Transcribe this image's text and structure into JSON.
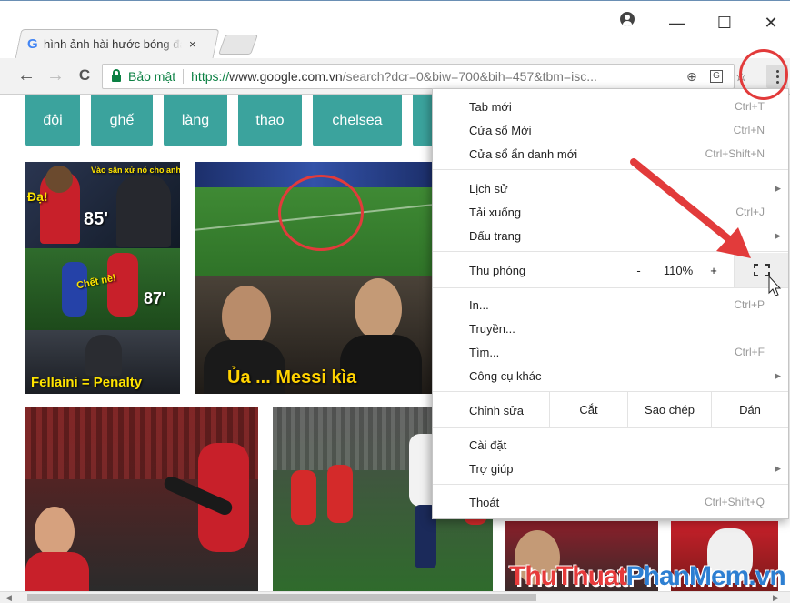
{
  "tab": {
    "icon": "G",
    "title": "hình ảnh hài hước bóng đá",
    "close": "×"
  },
  "window_controls": {
    "minimize": "—",
    "maximize": "☐",
    "close": "✕"
  },
  "toolbar": {
    "back": "←",
    "forward": "→",
    "reload": "C",
    "secure_label": "Bảo mật",
    "url_scheme": "https://",
    "url_host": "www.google.com.vn",
    "url_rest": "/search?dcr=0&biw=700&bih=457&tbm=isc...",
    "zoom_icon": "⊕",
    "translate_icon": "G",
    "bookmark_icon": "☆"
  },
  "chips": [
    "đội",
    "ghế",
    "làng",
    "thao",
    "chelsea"
  ],
  "captions": {
    "img1_top": "Vào sân xử nó cho anh!",
    "img1_da": "Đạ!",
    "img1_85": "85'",
    "img1_chet": "Chết nè!",
    "img1_87": "87'",
    "img1_bottom": "Fellaini = Penalty",
    "img2_bottom": "Ủa ... Messi kìa"
  },
  "watermark": {
    "part1": "ThuThuat",
    "part2": "PhanMem",
    "part3": ".vn"
  },
  "menu": {
    "items_top": [
      {
        "label": "Tab mới",
        "shortcut": "Ctrl+T"
      },
      {
        "label": "Cửa sổ Mới",
        "shortcut": "Ctrl+N"
      },
      {
        "label": "Cửa sổ ẩn danh mới",
        "shortcut": "Ctrl+Shift+N"
      }
    ],
    "items_history": [
      {
        "label": "Lịch sử",
        "shortcut": ""
      },
      {
        "label": "Tải xuống",
        "shortcut": "Ctrl+J"
      },
      {
        "label": "Dấu trang",
        "shortcut": ""
      }
    ],
    "zoom": {
      "label": "Thu phóng",
      "minus": "-",
      "value": "110%",
      "plus": "+"
    },
    "items_tools": [
      {
        "label": "In...",
        "shortcut": "Ctrl+P"
      },
      {
        "label": "Truyền...",
        "shortcut": ""
      },
      {
        "label": "Tìm...",
        "shortcut": "Ctrl+F"
      },
      {
        "label": "Công cụ khác",
        "shortcut": ""
      }
    ],
    "edit": {
      "label": "Chỉnh sửa",
      "cut": "Cắt",
      "copy": "Sao chép",
      "paste": "Dán"
    },
    "items_settings": [
      {
        "label": "Cài đặt",
        "shortcut": ""
      },
      {
        "label": "Trợ giúp",
        "shortcut": ""
      }
    ],
    "exit": {
      "label": "Thoát",
      "shortcut": "Ctrl+Shift+Q"
    }
  },
  "colors": {
    "chip": "#3ba39d",
    "annotation_red": "#e23b3b",
    "secure_green": "#0b8043"
  }
}
